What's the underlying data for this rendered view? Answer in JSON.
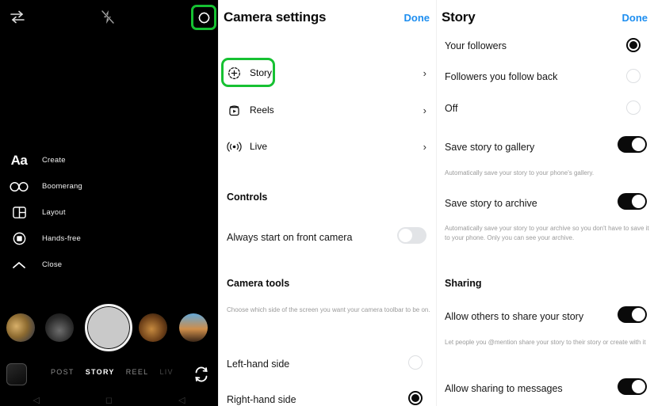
{
  "camera": {
    "top_icons": [
      {
        "name": "switch-camera-icon",
        "glyph": "switch"
      },
      {
        "name": "flash-off-icon",
        "glyph": "flash-off"
      },
      {
        "name": "camera-settings-icon",
        "glyph": "gear"
      }
    ],
    "highlight_color": "#16c132",
    "tools": [
      {
        "icon": "text-create-icon",
        "label": "Create"
      },
      {
        "icon": "boomerang-icon",
        "label": "Boomerang"
      },
      {
        "icon": "layout-icon",
        "label": "Layout"
      },
      {
        "icon": "hands-free-icon",
        "label": "Hands-free"
      },
      {
        "icon": "chevron-up-close-icon",
        "label": "Close"
      }
    ],
    "modes": [
      {
        "label": "POST",
        "state": "inactive"
      },
      {
        "label": "STORY",
        "state": "active"
      },
      {
        "label": "REEL",
        "state": "inactive"
      },
      {
        "label": "LIV",
        "state": "dim"
      }
    ],
    "shutter_name": "shutter-button",
    "flip_icon": "flip-camera-icon",
    "gallery_thumb": "gallery-thumbnail"
  },
  "settings": {
    "title": "Camera settings",
    "done_label": "Done",
    "nav_rows": [
      {
        "icon": "story-plus-icon",
        "label": "Story",
        "highlighted": true
      },
      {
        "icon": "reels-icon",
        "label": "Reels",
        "highlighted": false
      },
      {
        "icon": "live-broadcast-icon",
        "label": "Live",
        "highlighted": false
      }
    ],
    "controls_heading": "Controls",
    "front_camera_label": "Always start on front camera",
    "front_camera_state": "off",
    "camera_tools_heading": "Camera tools",
    "camera_tools_desc": "Choose which side of the screen you want your camera toolbar to be on.",
    "side_options": [
      {
        "label": "Left-hand side",
        "selected": false
      },
      {
        "label": "Right-hand side",
        "selected": true
      }
    ]
  },
  "story": {
    "title": "Story",
    "done_label": "Done",
    "audience_options": [
      {
        "label": "Your followers",
        "selected": true
      },
      {
        "label": "Followers you follow back",
        "selected": false
      },
      {
        "label": "Off",
        "selected": false
      }
    ],
    "save_gallery_label": "Save story to gallery",
    "save_gallery_state": "on",
    "save_gallery_desc": "Automatically save your story to your phone's gallery.",
    "save_archive_label": "Save story to archive",
    "save_archive_state": "on",
    "save_archive_desc": "Automatically save your story to your archive so you don't have to save it to your phone. Only you can see your archive.",
    "sharing_heading": "Sharing",
    "allow_share_label": "Allow others to share your story",
    "allow_share_state": "on",
    "allow_share_desc": "Let people you @mention share your story to their story or create with it",
    "allow_messages_label": "Allow sharing to messages",
    "allow_messages_state": "on"
  }
}
